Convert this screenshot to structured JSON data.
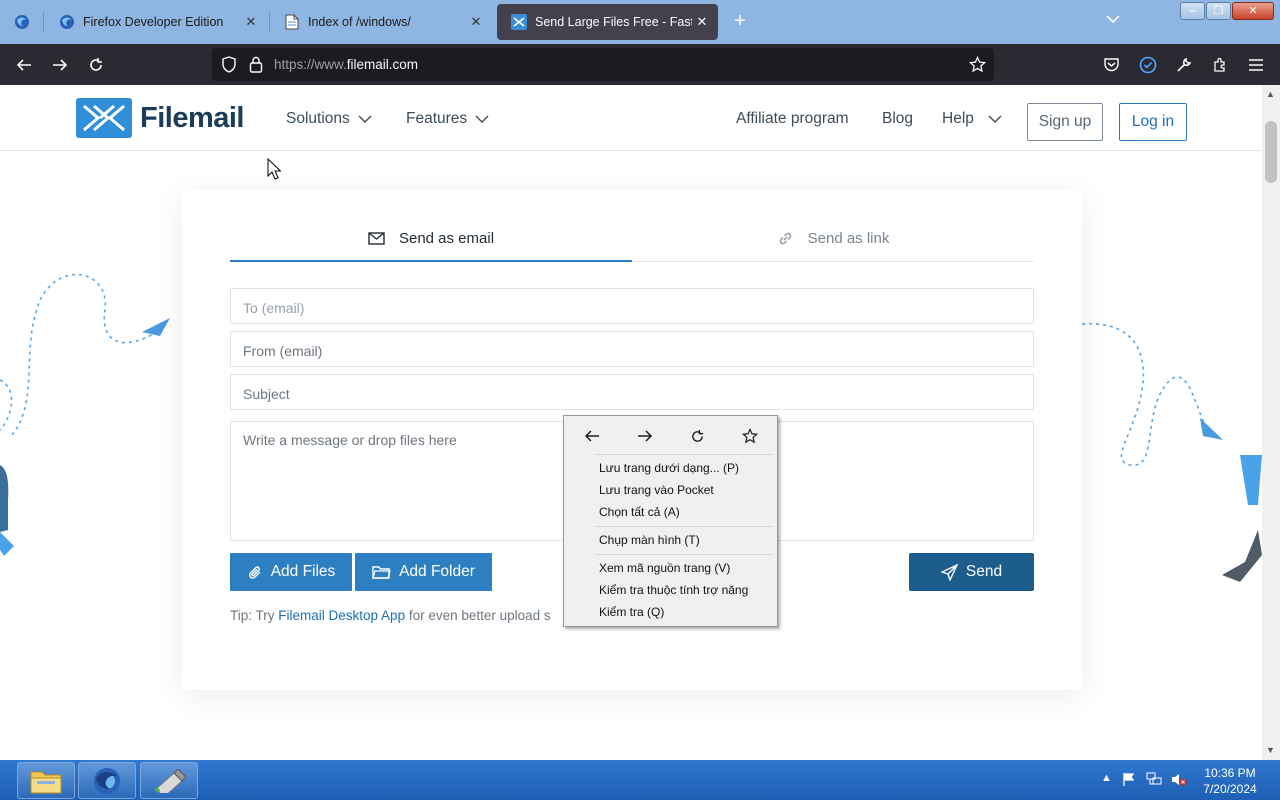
{
  "browser": {
    "tabs": [
      {
        "label": "Firefox Developer Edition",
        "close": "✕"
      },
      {
        "label": "Index of /windows/",
        "close": "✕"
      },
      {
        "label": "Send Large Files Free - Fast Sec",
        "close": "✕",
        "active": true
      }
    ],
    "url_prefix": "https://www.",
    "url_domain": "filemail.com"
  },
  "site": {
    "logo": "Filemail",
    "nav": {
      "solutions": "Solutions",
      "features": "Features",
      "affiliate": "Affiliate program",
      "blog": "Blog",
      "help": "Help"
    },
    "signup": "Sign up",
    "login": "Log in"
  },
  "form": {
    "tab_email": "Send as email",
    "tab_link": "Send as link",
    "to_placeholder": "To (email)",
    "from_placeholder": "From (email)",
    "subject_placeholder": "Subject",
    "message_placeholder": "Write a message or drop files here",
    "add_files": "Add Files",
    "add_folder": "Add Folder",
    "send": "Send",
    "tip_prefix": "Tip: Try ",
    "tip_link": "Filemail Desktop App",
    "tip_suffix": " for even better upload s"
  },
  "context_menu": {
    "items": [
      "Lưu trang dưới dạng... (P)",
      "Lưu trang vào Pocket",
      "Chọn tất cả (A)",
      "Chụp màn hình (T)",
      "Xem mã nguồn trang (V)",
      "Kiểm tra thuộc tính trợ năng",
      "Kiểm tra (Q)"
    ]
  },
  "taskbar": {
    "time": "10:36 PM",
    "date": "7/20/2024"
  },
  "colors": {
    "accent": "#2e7fc2",
    "send_button": "#1d5d8e",
    "tabstrip": "#8fb6e2",
    "toolbar": "#2b2a33",
    "taskbar": "#2468c0"
  }
}
